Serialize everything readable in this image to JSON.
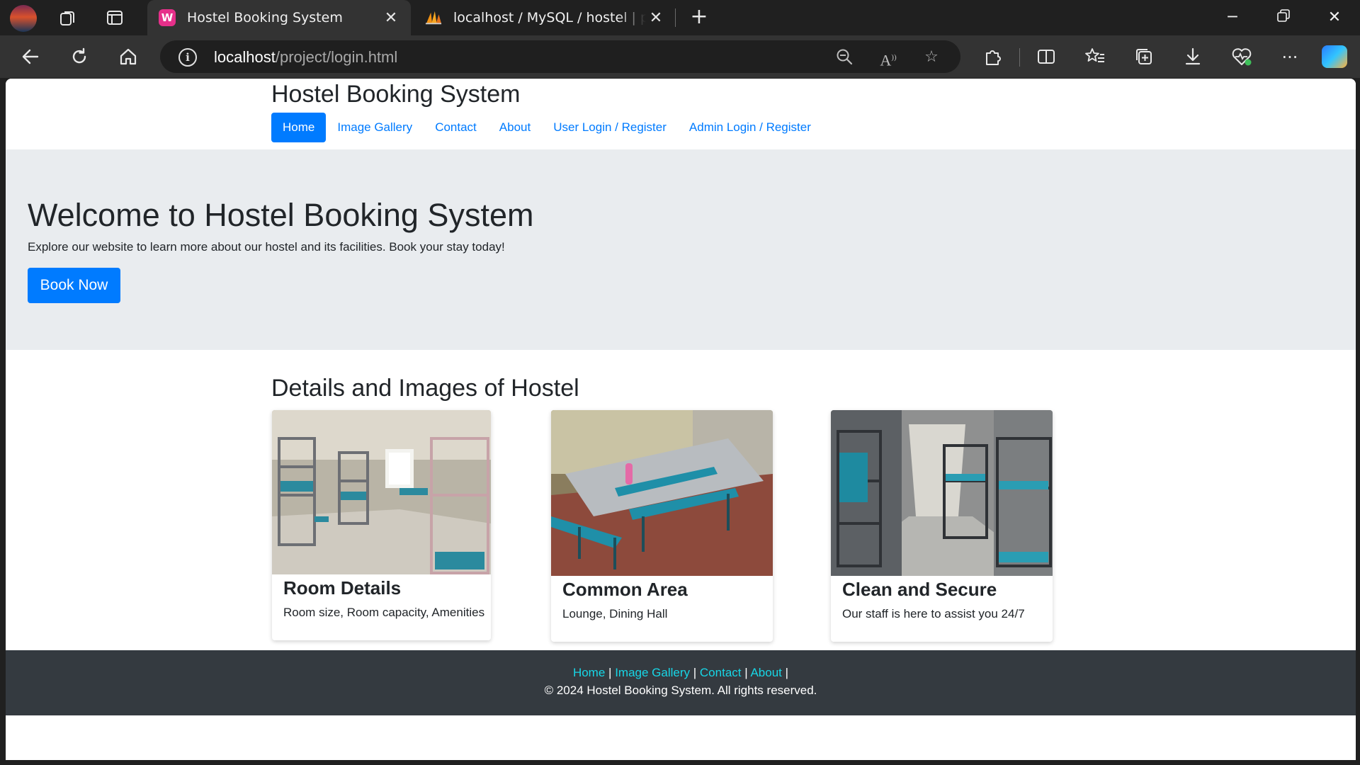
{
  "browser": {
    "tabs": [
      {
        "title": "Hostel Booking System",
        "active": true
      },
      {
        "title": "localhost / MySQL / hostel | phpMyAdmin",
        "active": false
      }
    ],
    "address": {
      "host": "localhost",
      "path": "/project/login.html"
    }
  },
  "site": {
    "title": "Hostel Booking System",
    "nav": [
      {
        "label": "Home",
        "active": true
      },
      {
        "label": "Image Gallery",
        "active": false
      },
      {
        "label": "Contact",
        "active": false
      },
      {
        "label": "About",
        "active": false
      },
      {
        "label": "User Login / Register",
        "active": false
      },
      {
        "label": "Admin Login / Register",
        "active": false
      }
    ]
  },
  "hero": {
    "heading": "Welcome to Hostel Booking System",
    "text": "Explore our website to learn more about our hostel and its facilities. Book your stay today!",
    "button": "Book Now"
  },
  "details": {
    "heading": "Details and Images of Hostel",
    "cards": [
      {
        "title": "Room Details",
        "text": "Room size, Room capacity, Amenities"
      },
      {
        "title": "Common Area",
        "text": "Lounge, Dining Hall"
      },
      {
        "title": "Clean and Secure",
        "text": "Our staff is here to assist you 24/7"
      }
    ]
  },
  "footer": {
    "links": [
      "Home",
      "Image Gallery",
      "Contact",
      "About"
    ],
    "separator": "|",
    "copyright": "© 2024 Hostel Booking System. All rights reserved."
  },
  "colors": {
    "primary": "#007bff",
    "hero_bg": "#e9ecef",
    "footer_bg": "#343a40",
    "footer_link": "#17d6e6"
  }
}
